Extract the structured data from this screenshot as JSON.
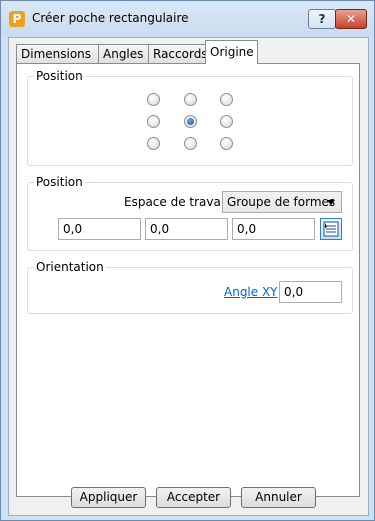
{
  "window": {
    "title": "Créer poche rectangulaire",
    "app_icon_letter": "P",
    "help_glyph": "?",
    "close_glyph": "✕"
  },
  "tabs": [
    {
      "label": "Dimensions",
      "active": false
    },
    {
      "label": "Angles",
      "active": false
    },
    {
      "label": "Raccords",
      "active": false
    },
    {
      "label": "Origine",
      "active": true
    }
  ],
  "origin_group": {
    "label": "Position",
    "selected_index": 4
  },
  "position_group": {
    "label": "Position",
    "workspace_label": "Espace de travail",
    "workspace_value": "Groupe de formes",
    "x": "0,0",
    "y": "0,0",
    "z": "0,0"
  },
  "orientation_group": {
    "label": "Orientation",
    "angle_link": "Angle XY",
    "angle_value": "0,0"
  },
  "buttons": {
    "apply": "Appliquer",
    "accept": "Accepter",
    "cancel": "Annuler"
  },
  "colors": {
    "accent": "#1b4f8a",
    "link": "#0066cc",
    "close": "#c7412a"
  }
}
